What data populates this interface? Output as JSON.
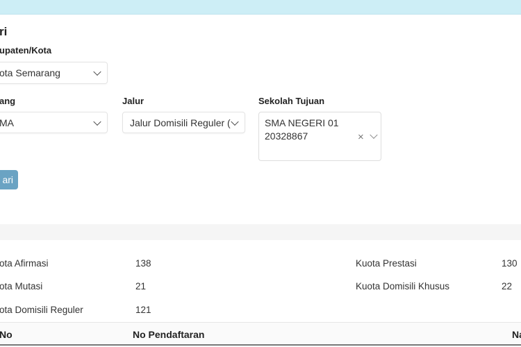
{
  "header": {
    "title": "ri"
  },
  "filters": {
    "kabupaten_label": "upaten/Kota",
    "kabupaten_value": "ota Semarang",
    "jenjang_label": "ang",
    "jenjang_value": "MA",
    "jalur_label": "Jalur",
    "jalur_value": "Jalur Domisili Reguler (",
    "sekolah_label": "Sekolah Tujuan",
    "sekolah_line1": "SMA NEGERI 01",
    "sekolah_line2": "20328867",
    "search_button": "ari"
  },
  "quota": {
    "left": [
      {
        "label": "ota Afirmasi",
        "value": "138"
      },
      {
        "label": "ota Mutasi",
        "value": "21"
      },
      {
        "label": "ota Domisili Reguler",
        "value": "121"
      }
    ],
    "right": [
      {
        "label": "Kuota Prestasi",
        "value": "130"
      },
      {
        "label": "Kuota Domisili Khusus",
        "value": "22"
      }
    ]
  },
  "table": {
    "headers": [
      "No",
      "No Pendaftaran",
      "Na"
    ]
  },
  "colors": {
    "topbar": "#cdeef6",
    "button": "#6aa3c3"
  }
}
